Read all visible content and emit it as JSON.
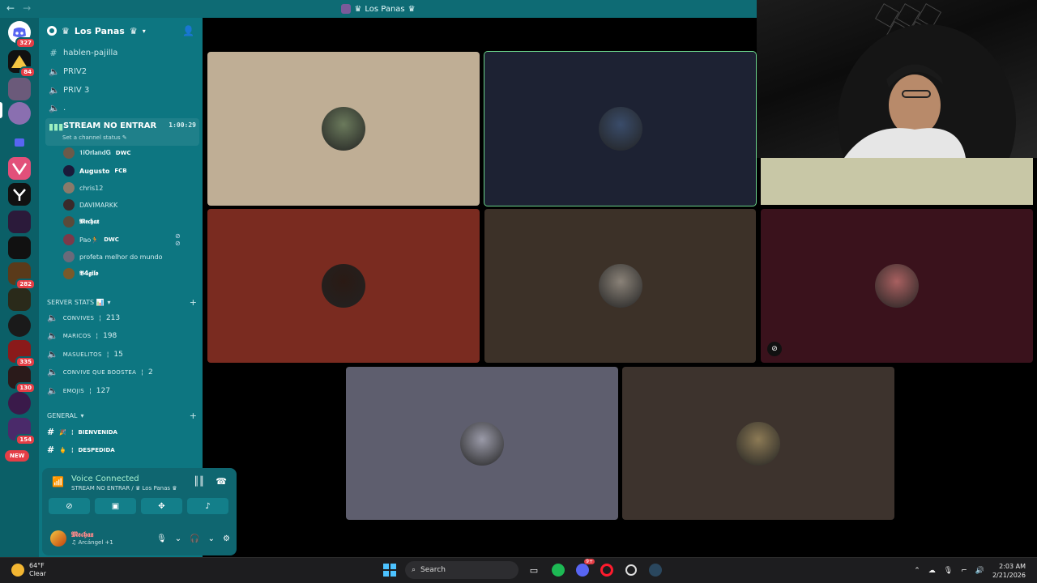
{
  "window": {
    "title": "Los Panas",
    "title_decoration": "♛",
    "back": "←",
    "forward": "→"
  },
  "rail": {
    "badges": [
      "327",
      "84",
      "282",
      "335",
      "130",
      "154"
    ],
    "new_label": "NEW"
  },
  "guild": {
    "name": "Los Panas",
    "decoration": "♛"
  },
  "channels": [
    {
      "icon": "#",
      "name": "hablen-pajilla"
    },
    {
      "icon": "🔊",
      "name": "PRIV2"
    },
    {
      "icon": "🔊",
      "name": "PRIV 3"
    },
    {
      "icon": "🔊",
      "name": "."
    }
  ],
  "active_channel": {
    "name": "STREAM NO ENTRAR",
    "timer": "1:00:29",
    "status": "Set a channel status"
  },
  "voice_users": [
    {
      "name": "𝟏𝐢𝐎𝐫𝐥𝐚𝐧𝐝𝐆",
      "tag": "DWC",
      "bold": false
    },
    {
      "name": "Augusto",
      "tag": "FCB",
      "bold": true
    },
    {
      "name": "chris12",
      "tag": "",
      "bold": false
    },
    {
      "name": "DAVIMARKK",
      "tag": "",
      "bold": false
    },
    {
      "name": "𝕸𝖊𝖈𝖍𝖆𝖝",
      "tag": "",
      "bold": true
    },
    {
      "name": "Pao🏃",
      "tag": "DWC",
      "bold": false
    },
    {
      "name": "profeta melhor do mundo",
      "tag": "",
      "bold": false
    },
    {
      "name": "𝕭4𝖌𝖎𝖑𝖔",
      "tag": "",
      "bold": true
    }
  ],
  "server_stats": {
    "label": "SERVER STATS 📊",
    "items": [
      {
        "name": "CONVIVES",
        "value": "213"
      },
      {
        "name": "MARICOS",
        "value": "198"
      },
      {
        "name": "MASUELITOS",
        "value": "15"
      },
      {
        "name": "CONVIVE QUE BOOSTEA",
        "value": "2"
      },
      {
        "name": "EMOJIS",
        "value": "127"
      }
    ]
  },
  "general": {
    "label": "GENERAL",
    "items": [
      {
        "emoji": "🎉",
        "name": "BIENVENIDA"
      },
      {
        "emoji": "🖕",
        "name": "DESPEDIDA"
      }
    ]
  },
  "voice_panel": {
    "status": "Voice Connected",
    "location": "STREAM NO ENTRAR / ♛ Los Panas ♛"
  },
  "me": {
    "name": "𝕸𝖊𝖈𝖍𝖆𝖝",
    "status": "♫ Arcángel +1"
  },
  "tiles": [
    {
      "bg": "#bfae95",
      "avatar": "#6b7a5c",
      "speaking": false
    },
    {
      "bg": "#1d2233",
      "avatar": "#3a4c6a",
      "speaking": true
    },
    {
      "bg": "#7a2b20",
      "avatar": "#2a1a14",
      "speaking": false
    },
    {
      "bg": "#3c3128",
      "avatar": "#8a8278",
      "speaking": false
    },
    {
      "bg": "#3a121c",
      "avatar": "#a86060",
      "speaking": false
    },
    {
      "bg": "#5e5e6e",
      "avatar": "#9a9aa8",
      "speaking": false
    },
    {
      "bg": "#3d332d",
      "avatar": "#8c7a55",
      "speaking": false
    }
  ],
  "taskbar": {
    "temp": "64°F",
    "cond": "Clear",
    "search": "Search",
    "time": "2:03 AM",
    "date": "2/21/2026",
    "notif": "9+"
  }
}
